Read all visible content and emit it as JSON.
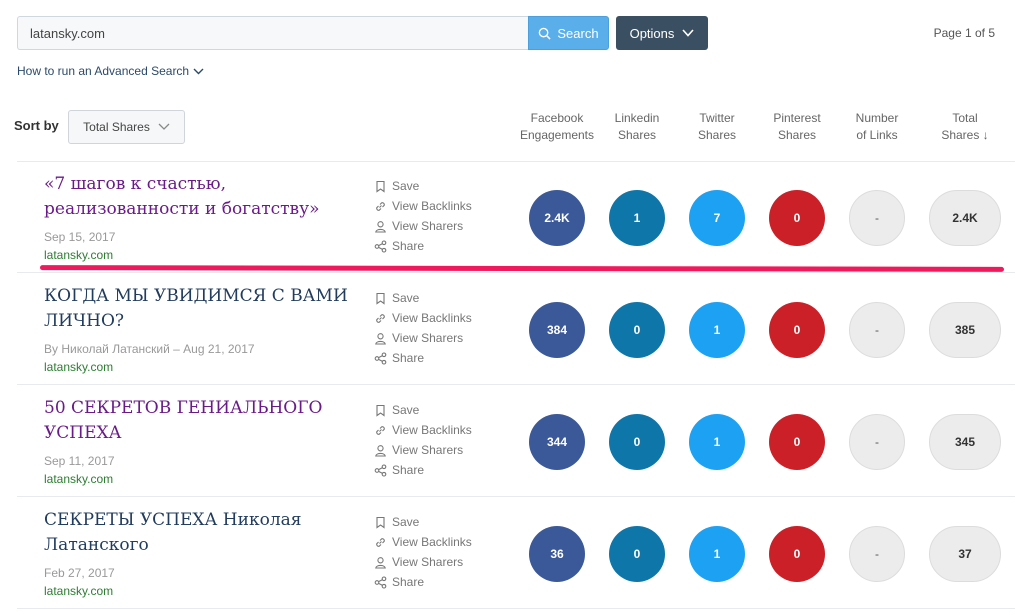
{
  "search": {
    "value": "latansky.com",
    "button_label": "Search",
    "options_label": "Options"
  },
  "page_indicator": "Page 1 of 5",
  "advanced_search_link": "How to run an Advanced Search",
  "sort": {
    "label": "Sort by",
    "selected": "Total Shares"
  },
  "columns": [
    {
      "line1": "Facebook",
      "line2": "Engagements"
    },
    {
      "line1": "Linkedin",
      "line2": "Shares"
    },
    {
      "line1": "Twitter",
      "line2": "Shares"
    },
    {
      "line1": "Pinterest",
      "line2": "Shares"
    },
    {
      "line1": "Number",
      "line2": "of Links"
    },
    {
      "line1": "Total",
      "line2": "Shares ↓"
    }
  ],
  "actions": {
    "save": "Save",
    "backlinks": "View Backlinks",
    "sharers": "View Sharers",
    "share": "Share"
  },
  "colors": {
    "facebook": "#3b5998",
    "linkedin": "#0e76a8",
    "twitter": "#1da1f2",
    "pinterest": "#cb2027",
    "highlight": "#f0195e"
  },
  "articles": [
    {
      "title": "«7 шагов к счастью, реализованности и богатству»",
      "meta": "Sep 15, 2017",
      "domain": "latansky.com",
      "facebook": "2.4K",
      "linkedin": "1",
      "twitter": "7",
      "pinterest": "0",
      "links": "-",
      "total": "2.4K"
    },
    {
      "title": "КОГДА МЫ УВИДИМСЯ С ВАМИ ЛИЧНО?",
      "meta": "By Николай Латанский – Aug 21, 2017",
      "domain": "latansky.com",
      "facebook": "384",
      "linkedin": "0",
      "twitter": "1",
      "pinterest": "0",
      "links": "-",
      "total": "385"
    },
    {
      "title": "50 СЕКРЕТОВ ГЕНИАЛЬНОГО УСПЕХА",
      "meta": "Sep 11, 2017",
      "domain": "latansky.com",
      "facebook": "344",
      "linkedin": "0",
      "twitter": "1",
      "pinterest": "0",
      "links": "-",
      "total": "345"
    },
    {
      "title": "СЕКРЕТЫ УСПЕХА Николая Латанского",
      "meta": "Feb 27, 2017",
      "domain": "latansky.com",
      "facebook": "36",
      "linkedin": "0",
      "twitter": "1",
      "pinterest": "0",
      "links": "-",
      "total": "37"
    }
  ]
}
